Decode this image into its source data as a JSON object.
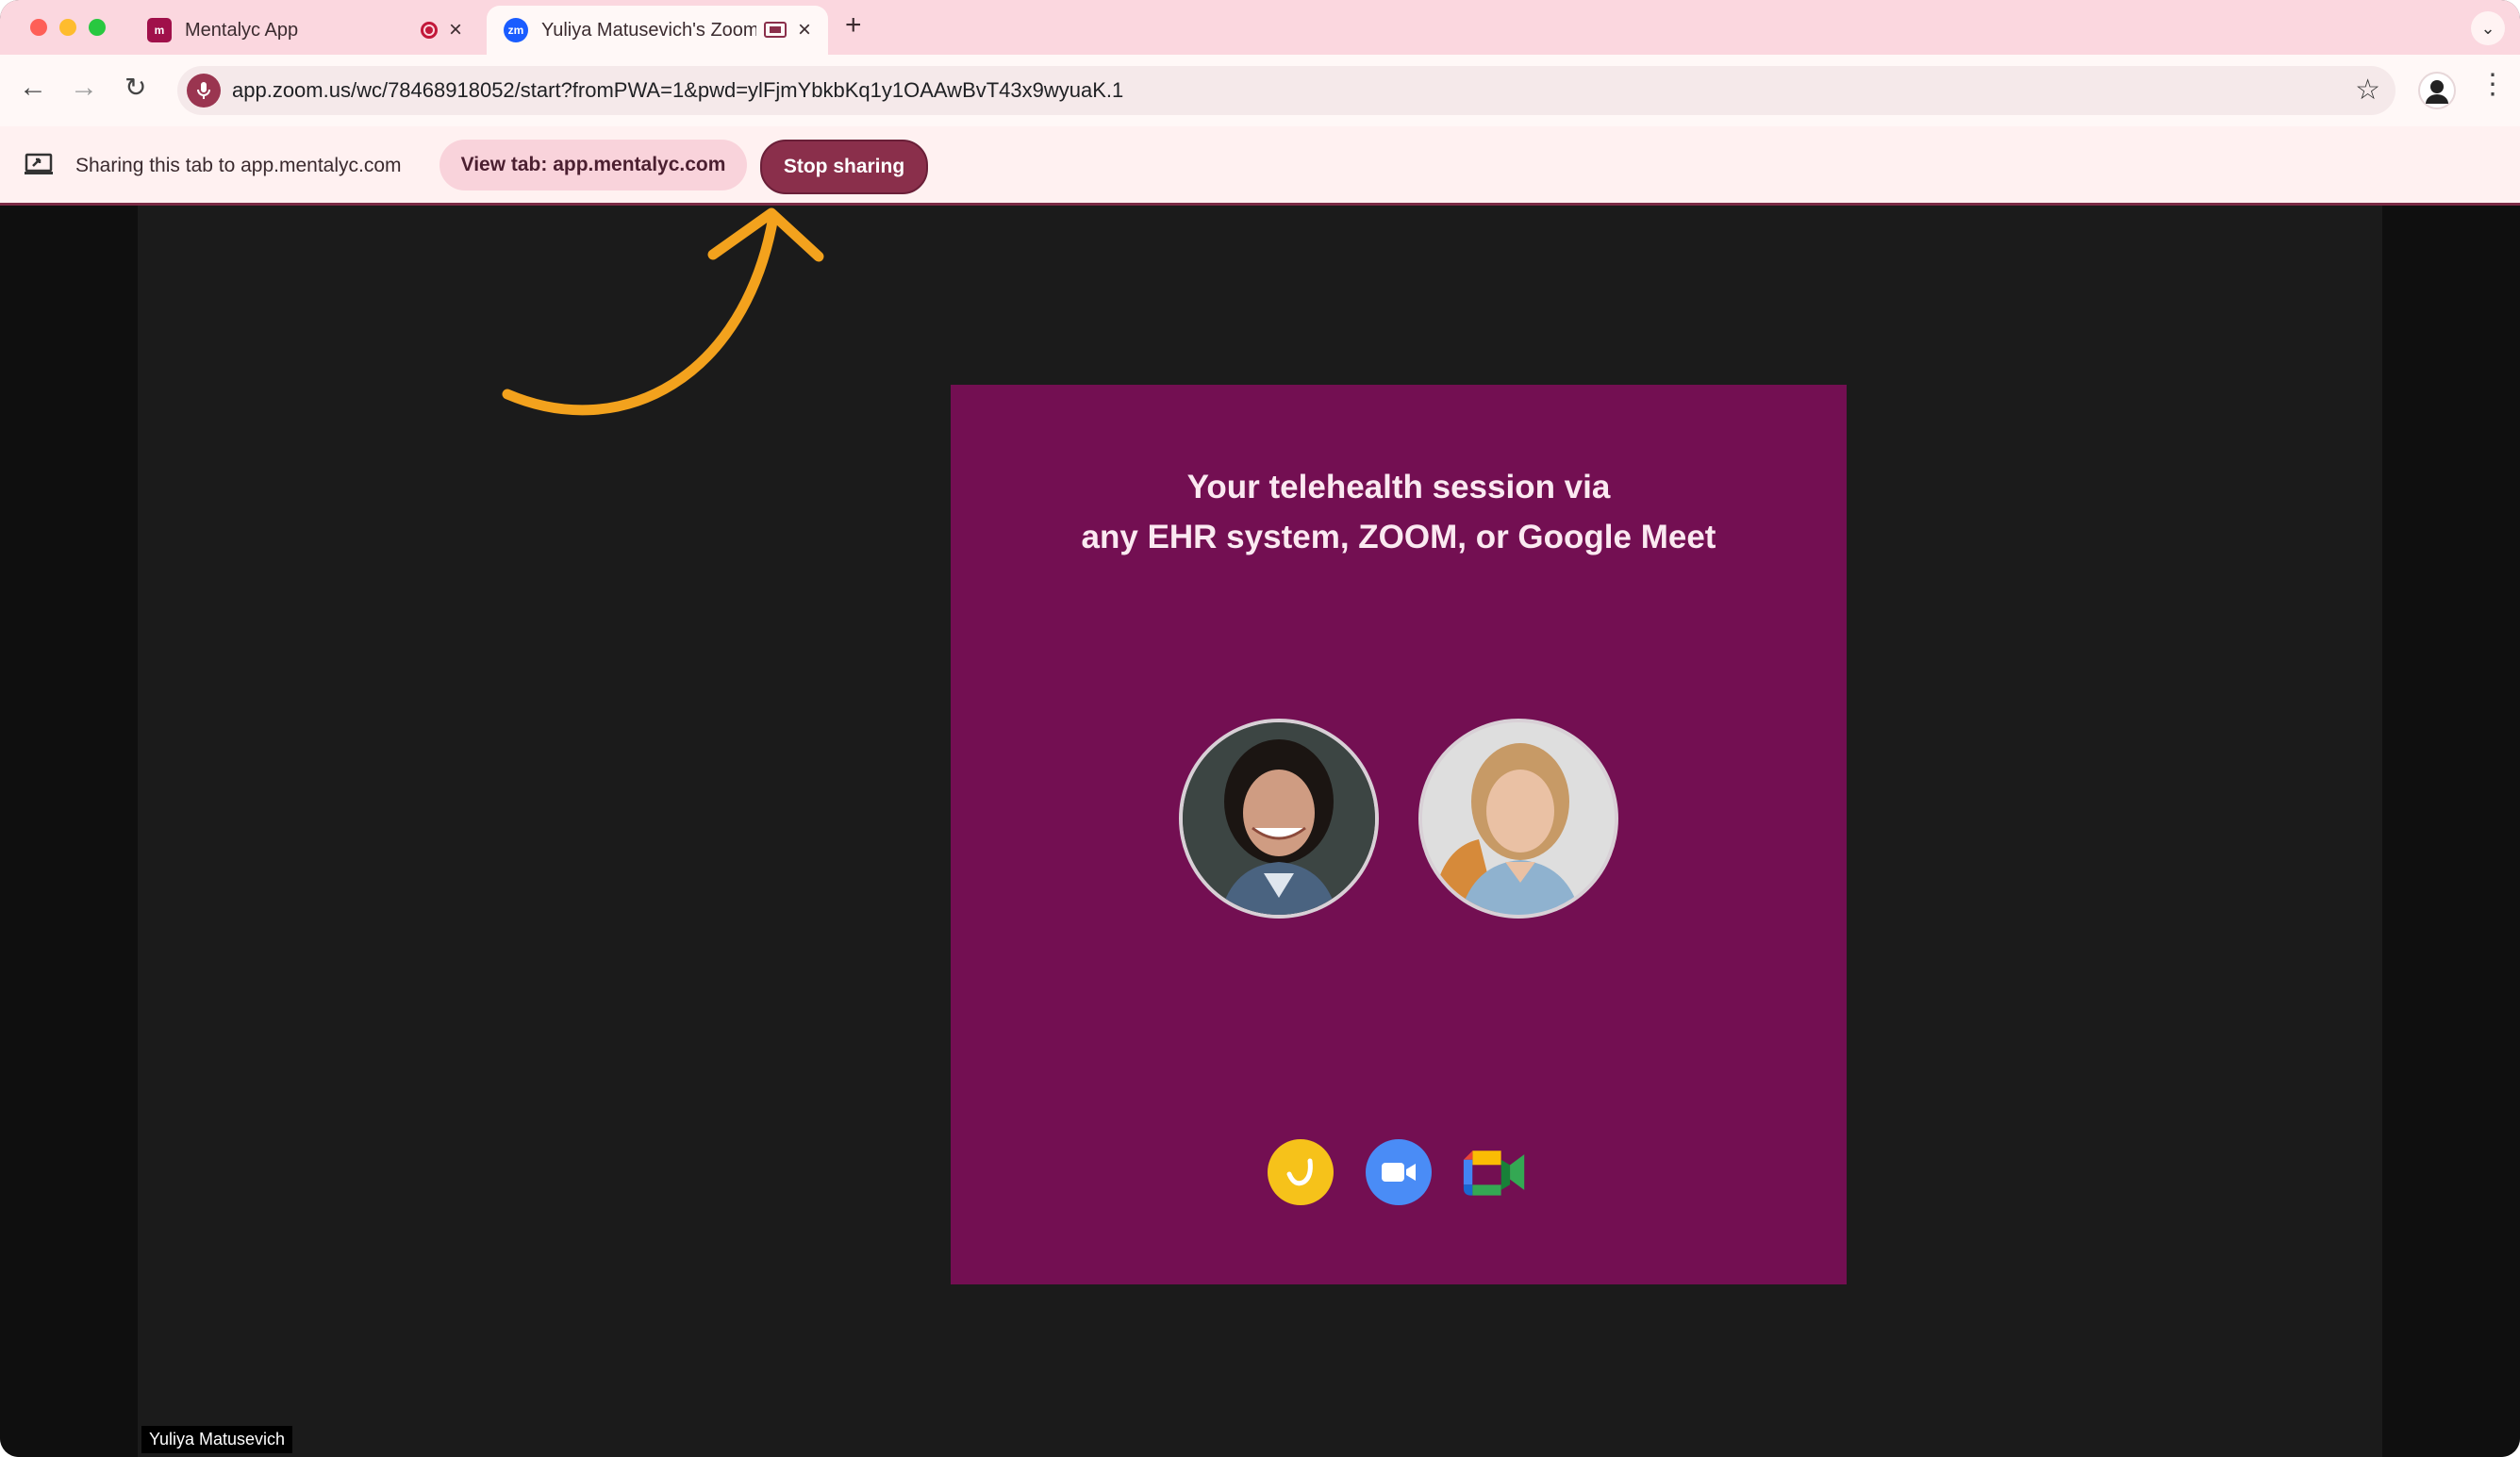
{
  "browser": {
    "tabs": [
      {
        "title": "Mentalyc App",
        "favicon": "m"
      },
      {
        "title": "Yuliya Matusevich's Zoom",
        "favicon": "zm"
      }
    ],
    "address_bar": {
      "url": "app.zoom.us/wc/78468918052/start?fromPWA=1&pwd=ylFjmYbkbKq1y1OAAwBvT43x9wyuaK.1"
    }
  },
  "share_bar": {
    "message": "Sharing this tab to app.mentalyc.com",
    "view_tab_label": "View tab: app.mentalyc.com",
    "stop_label": "Stop sharing"
  },
  "slide": {
    "title_line1": "Your telehealth session via",
    "title_line2": "any EHR system, ZOOM, or Google Meet",
    "logos": [
      "ehr-icon",
      "zoom-icon",
      "google-meet-icon"
    ]
  },
  "participant": {
    "name": "Yuliya Matusevich"
  },
  "colors": {
    "tab_strip": "#fbd7df",
    "stop_button": "#8a2f4b",
    "slide_background": "#730f52",
    "annotation_arrow": "#f3a21d"
  }
}
